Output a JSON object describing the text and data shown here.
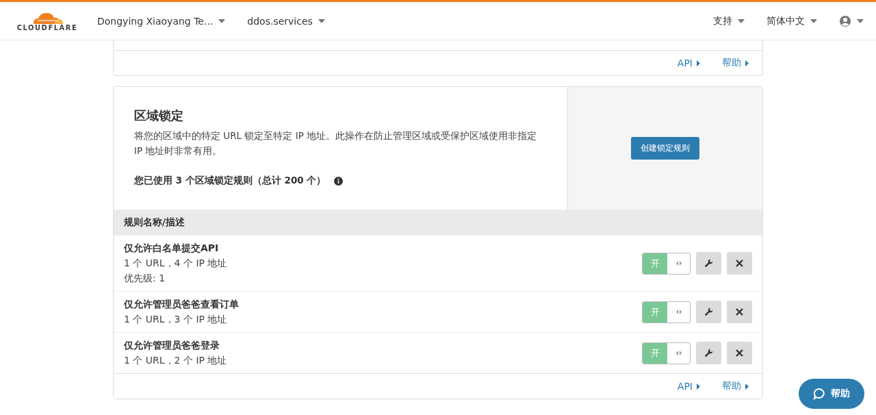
{
  "header": {
    "logo": "CLOUDFLARE",
    "account": "Dongying Xiaoyang Te...",
    "domain": "ddos.services",
    "support": "支持",
    "language": "简体中文"
  },
  "top_card": {
    "links": [
      "API",
      "帮助"
    ]
  },
  "zone_lockdown": {
    "title": "区域锁定",
    "description": "将您的区域中的特定 URL 锁定至特定 IP 地址。此操作在防止管理区域或受保护区域使用非指定 IP 地址时非常有用。",
    "usage": "您已使用 3 个区域锁定规则（总计 200 个）",
    "create_button": "创建锁定规则",
    "table": {
      "column": "规则名称/描述",
      "rows": [
        {
          "name": "仅允许白名单提交API",
          "details": [
            "1 个 URL，4 个 IP 地址",
            "优先级: 1"
          ],
          "on": true,
          "toggle_label": "开"
        },
        {
          "name": "仅允许管理员爸爸查看订单",
          "details": [
            "1 个 URL，3 个 IP 地址"
          ],
          "on": true,
          "toggle_label": "开"
        },
        {
          "name": "仅允许管理员爸爸登录",
          "details": [
            "1 个 URL，2 个 IP 地址"
          ],
          "on": true,
          "toggle_label": "开"
        }
      ]
    },
    "links": [
      "API",
      "帮助"
    ]
  },
  "help_button": "帮助"
}
